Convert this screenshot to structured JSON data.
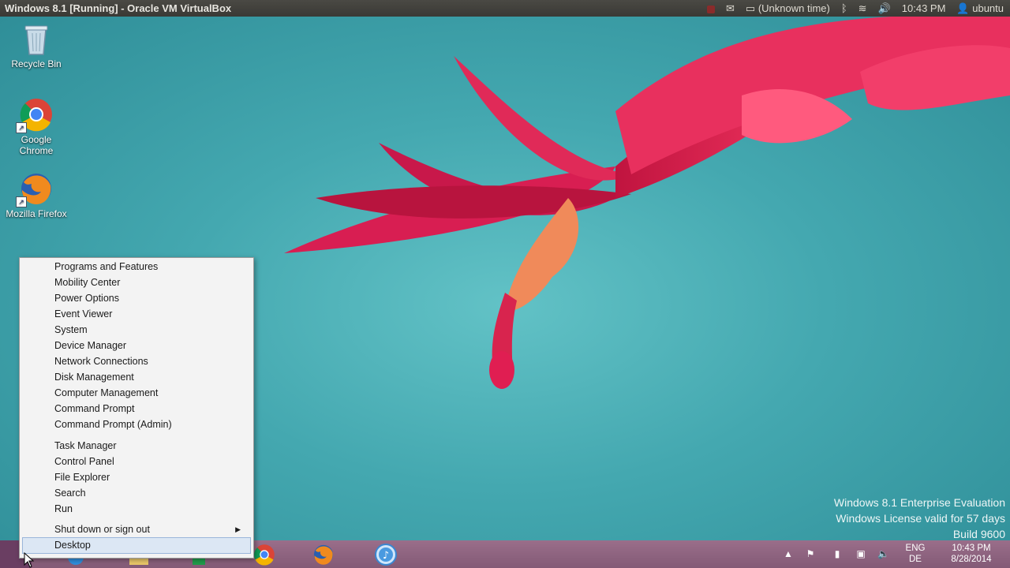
{
  "topbar": {
    "window_title": "Windows 8.1 [Running] - Oracle VM VirtualBox",
    "battery_text": "(Unknown time)",
    "time": "10:43 PM",
    "user": "ubuntu"
  },
  "desktop": {
    "icons": [
      {
        "label": "Recycle Bin",
        "icon": "recycle-bin-icon"
      },
      {
        "label": "Google Chrome",
        "icon": "chrome-icon"
      },
      {
        "label": "Mozilla Firefox",
        "icon": "firefox-icon"
      }
    ],
    "watermark": {
      "line1": "Windows 8.1 Enterprise Evaluation",
      "line2": "Windows License valid for 57 days",
      "line3": "Build 9600"
    }
  },
  "winx_menu": {
    "items": [
      "Programs and Features",
      "Mobility Center",
      "Power Options",
      "Event Viewer",
      "System",
      "Device Manager",
      "Network Connections",
      "Disk Management",
      "Computer Management",
      "Command Prompt",
      "Command Prompt (Admin)",
      "Task Manager",
      "Control Panel",
      "File Explorer",
      "Search",
      "Run",
      "Shut down or sign out",
      "Desktop"
    ],
    "highlighted": "Desktop"
  },
  "taskbar": {
    "pinned": [
      "chrome-icon",
      "firefox-icon",
      "itunes-icon"
    ],
    "language": {
      "line1": "ENG",
      "line2": "DE"
    },
    "clock": {
      "time": "10:43 PM",
      "date": "8/28/2014"
    }
  },
  "colors": {
    "wallpaper": "#44a8b0",
    "flower": "#e0245a",
    "taskbar": "#8c6280",
    "menu_bg": "#f3f3f3",
    "menu_highlight": "#dce7f4"
  }
}
